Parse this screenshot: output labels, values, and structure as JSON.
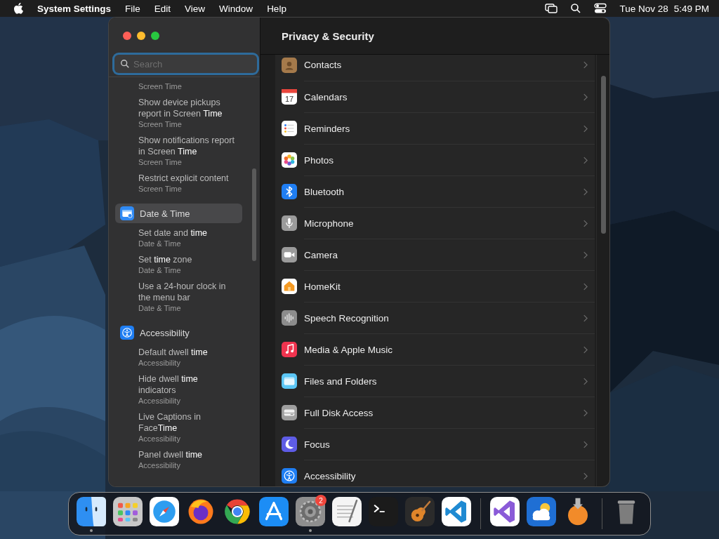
{
  "menu_bar": {
    "app_name": "System Settings",
    "menus": [
      "File",
      "Edit",
      "View",
      "Window",
      "Help"
    ],
    "date": "Tue Nov 28",
    "time": "5:49 PM"
  },
  "window": {
    "title": "Privacy & Security"
  },
  "sidebar": {
    "search": {
      "placeholder": "Search"
    },
    "sections": [
      {
        "results": [
          {
            "subtitle": "Screen Time"
          },
          {
            "title": "Show device pickups report in Screen **Time**",
            "subtitle": "Screen Time"
          },
          {
            "title": "Show notifications report in Screen **Time**",
            "subtitle": "Screen Time"
          },
          {
            "title": "Restrict explicit content",
            "subtitle": "Screen Time"
          }
        ]
      },
      {
        "label": "Date & Time",
        "kind": "datetime",
        "selected": true,
        "results": [
          {
            "title": "Set date and **time**",
            "subtitle": "Date & Time"
          },
          {
            "title": "Set **time** zone",
            "subtitle": "Date & Time"
          },
          {
            "title": "Use a 24-hour clock in the menu bar",
            "subtitle": "Date & Time"
          }
        ]
      },
      {
        "label": "Accessibility",
        "kind": "accessibility",
        "selected": false,
        "results": [
          {
            "title": "Default dwell **time**",
            "subtitle": "Accessibility"
          },
          {
            "title": "Hide dwell **time** indicators",
            "subtitle": "Accessibility"
          },
          {
            "title": "Live Captions in Face**Time**",
            "subtitle": "Accessibility"
          },
          {
            "title": "Panel dwell **time**",
            "subtitle": "Accessibility"
          }
        ]
      }
    ]
  },
  "privacy_list": [
    {
      "label": "Contacts",
      "kind": "contacts"
    },
    {
      "label": "Calendars",
      "kind": "calendar",
      "icon_text": "17"
    },
    {
      "label": "Reminders",
      "kind": "reminders"
    },
    {
      "label": "Photos",
      "kind": "photos"
    },
    {
      "label": "Bluetooth",
      "kind": "bluetooth"
    },
    {
      "label": "Microphone",
      "kind": "microphone"
    },
    {
      "label": "Camera",
      "kind": "camera"
    },
    {
      "label": "HomeKit",
      "kind": "homekit"
    },
    {
      "label": "Speech Recognition",
      "kind": "speech"
    },
    {
      "label": "Media & Apple Music",
      "kind": "music"
    },
    {
      "label": "Files and Folders",
      "kind": "files"
    },
    {
      "label": "Full Disk Access",
      "kind": "disk"
    },
    {
      "label": "Focus",
      "kind": "focus"
    },
    {
      "label": "Accessibility",
      "kind": "accessibility"
    }
  ],
  "dock": {
    "groups": [
      [
        {
          "kind": "finder",
          "running": true
        },
        {
          "kind": "launchpad",
          "running": false
        },
        {
          "kind": "safari",
          "running": false
        },
        {
          "kind": "firefox",
          "running": false
        },
        {
          "kind": "chrome",
          "running": false
        },
        {
          "kind": "appstore",
          "running": false
        },
        {
          "kind": "settings",
          "running": true,
          "badge": "2"
        },
        {
          "kind": "textedit",
          "running": false
        },
        {
          "kind": "terminal",
          "running": false
        },
        {
          "kind": "garageband",
          "running": false
        },
        {
          "kind": "vscode",
          "running": false
        }
      ],
      [
        {
          "kind": "vsmac",
          "running": false
        },
        {
          "kind": "weather",
          "running": false
        },
        {
          "kind": "installer",
          "running": false
        }
      ],
      [
        {
          "kind": "trash",
          "running": false
        }
      ]
    ]
  }
}
